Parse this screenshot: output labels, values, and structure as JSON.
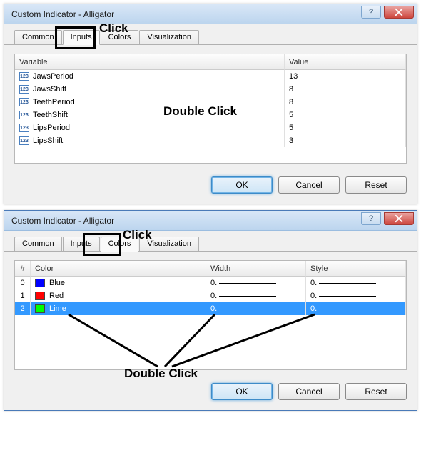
{
  "dialog1": {
    "title": "Custom Indicator - Alligator",
    "tabs": [
      "Common",
      "Inputs",
      "Colors",
      "Visualization"
    ],
    "activeTab": "Inputs",
    "headers": {
      "variable": "Variable",
      "value": "Value"
    },
    "rows": [
      {
        "name": "JawsPeriod",
        "value": "13"
      },
      {
        "name": "JawsShift",
        "value": "8"
      },
      {
        "name": "TeethPeriod",
        "value": "8"
      },
      {
        "name": "TeethShift",
        "value": "5"
      },
      {
        "name": "LipsPeriod",
        "value": "5"
      },
      {
        "name": "LipsShift",
        "value": "3"
      }
    ],
    "buttons": {
      "ok": "OK",
      "cancel": "Cancel",
      "reset": "Reset"
    }
  },
  "dialog2": {
    "title": "Custom Indicator - Alligator",
    "tabs": [
      "Common",
      "Inputs",
      "Colors",
      "Visualization"
    ],
    "activeTab": "Colors",
    "headers": {
      "idx": "#",
      "color": "Color",
      "width": "Width",
      "style": "Style"
    },
    "rows": [
      {
        "idx": "0",
        "color": "Blue",
        "swatch": "#0000ff",
        "width": "0.",
        "style": "0.",
        "selected": false
      },
      {
        "idx": "1",
        "color": "Red",
        "swatch": "#ff0000",
        "width": "0.",
        "style": "0.",
        "selected": false
      },
      {
        "idx": "2",
        "color": "Lime",
        "swatch": "#00ff00",
        "width": "0.",
        "style": "0.",
        "selected": true
      }
    ],
    "buttons": {
      "ok": "OK",
      "cancel": "Cancel",
      "reset": "Reset"
    }
  },
  "annotations": {
    "click1": "Click",
    "doubleClick1": "Double Click",
    "click2": "Click",
    "doubleClick2": "Double Click"
  }
}
